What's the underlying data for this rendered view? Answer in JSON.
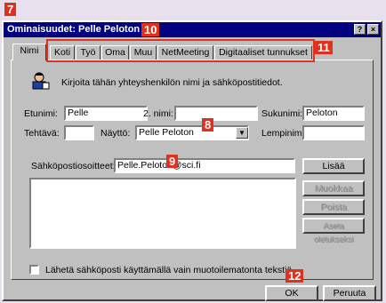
{
  "callouts": {
    "c7": "7",
    "c8": "8",
    "c9": "9",
    "c10": "10",
    "c11": "11",
    "c12": "12"
  },
  "window": {
    "title": "Ominaisuudet: Pelle Peloton",
    "help": "?",
    "close": "×"
  },
  "tabs": [
    "Nimi",
    "Koti",
    "Työ",
    "Oma",
    "Muu",
    "NetMeeting",
    "Digitaaliset tunnukset"
  ],
  "intro": "Kirjoita tähän yhteyshenkilön nimi ja sähköpostitiedot.",
  "form": {
    "first_label": "Etunimi:",
    "first_value": "Pelle",
    "middle_label": "2. nimi:",
    "middle_value": "",
    "last_label": "Sukunimi:",
    "last_value": "Peloton",
    "title_label": "Tehtävä:",
    "title_value": "",
    "display_label": "Näyttö:",
    "display_value": "Pelle Peloton",
    "nick_label": "Lempinimi:",
    "nick_value": ""
  },
  "email": {
    "label": "Sähköpostiosoitteet:",
    "value": "Pelle.Peloton@sci.fi",
    "add": "Lisää",
    "edit": "Muokkaa",
    "remove": "Poista",
    "default": "Aseta oletukseksi"
  },
  "plaintext_label": "Lähetä sähköposti käyttämällä vain muotoilematonta tekstiä.",
  "buttons": {
    "ok": "OK",
    "cancel": "Peruuta"
  }
}
